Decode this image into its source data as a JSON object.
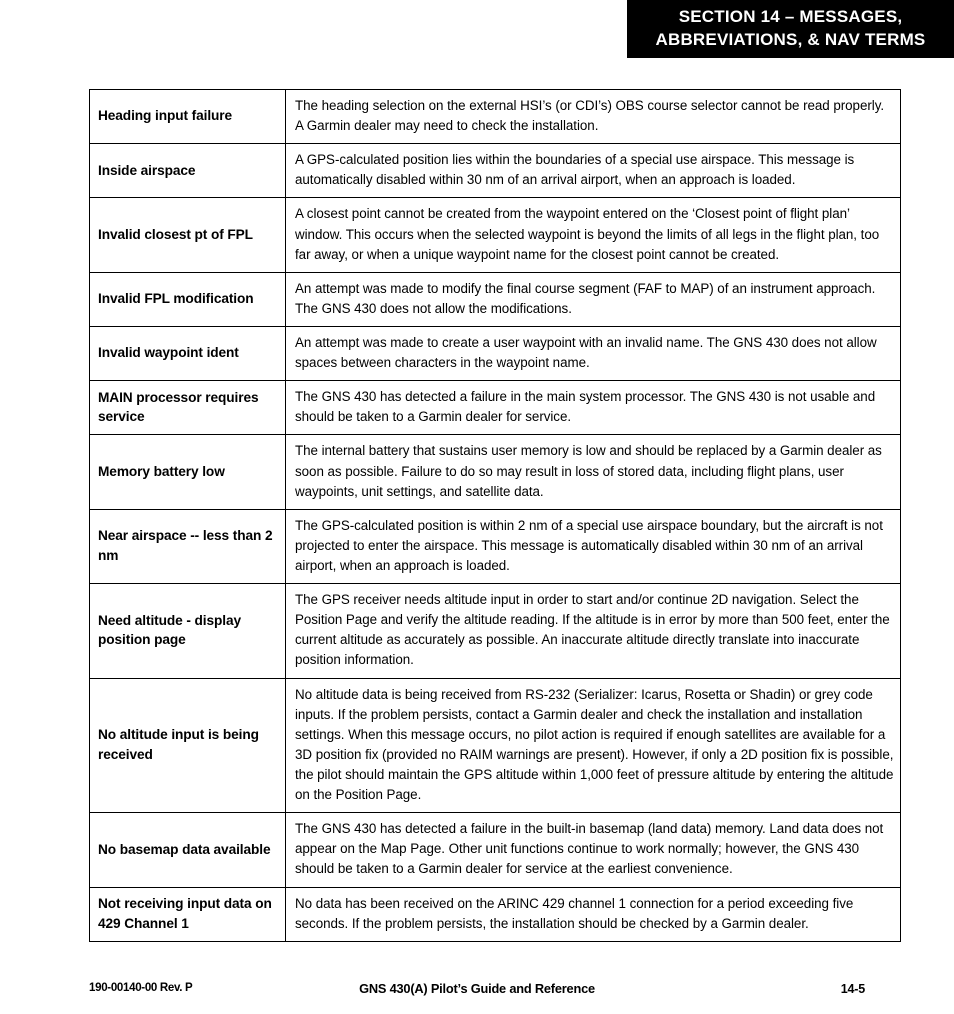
{
  "header": {
    "line1": "SECTION 14 – MESSAGES,",
    "line2": "ABBREVIATIONS, & NAV TERMS",
    "background_color": "#000000",
    "text_color": "#ffffff"
  },
  "table": {
    "rows": [
      {
        "message": "Heading input failure",
        "description": "The heading selection on the external HSI’s (or CDI’s) OBS course selector cannot be read properly.  A Garmin dealer may need to check the installation."
      },
      {
        "message": "Inside airspace",
        "description": "A GPS-calculated position lies within the boundaries of a special use airspace.  This message is automatically disabled within 30 nm of an arrival airport, when an approach is loaded."
      },
      {
        "message": "Invalid closest pt of FPL",
        "description": "A closest point cannot be created from the waypoint entered on the ‘Closest point of flight plan’ window.  This occurs when the selected waypoint is beyond the limits of all legs in the flight plan, too far away, or when a unique waypoint name for the closest point cannot be created."
      },
      {
        "message": "Invalid FPL modification",
        "description": "An attempt was made to modify the final course segment (FAF to MAP) of an instrument approach.  The GNS 430 does not allow the modifications."
      },
      {
        "message": "Invalid waypoint ident",
        "description": "An attempt was made to create a user waypoint with an invalid name.  The GNS 430 does not allow spaces between characters in the waypoint name."
      },
      {
        "message": "MAIN processor requires service",
        "description": "The GNS 430 has detected a failure in the main system processor.  The GNS 430 is not usable and should be taken to a Garmin dealer for service."
      },
      {
        "message": "Memory battery low",
        "description": "The internal battery that sustains user memory is low and should be replaced by a Garmin dealer as soon as possible.  Failure to do so may result in loss of stored data, including flight plans, user waypoints, unit settings, and satellite data."
      },
      {
        "message": "Near airspace -- less than 2 nm",
        "description": "The GPS-calculated position is within 2 nm of a special use airspace boundary, but the aircraft is  not projected to enter the airspace.  This message is automatically disabled within 30 nm of an arrival airport, when an approach is loaded."
      },
      {
        "message": "Need altitude - display position page",
        "description": "The GPS receiver needs altitude input in order to start and/or continue 2D navigation.  Select the Position Page and verify the altitude reading.  If the altitude is in error by more than 500 feet, enter the current altitude as accurately as possible.  An inaccurate altitude directly translate into inaccurate position information."
      },
      {
        "message": "No altitude input is being received",
        "description": "No altitude data is being received from RS-232 (Serializer: Icarus, Rosetta or Shadin) or grey code inputs.  If the problem persists, contact a Garmin dealer and check the installation and installation settings.  When this message occurs, no pilot action is required if enough satellites are available for a 3D position fix (provided no RAIM warnings are present).  However, if only a 2D position fix is possible, the pilot should maintain the GPS altitude within 1,000 feet of pressure altitude by entering the altitude on the Position Page."
      },
      {
        "message": "No basemap data available",
        "description": "The GNS 430 has detected a failure in the built-in basemap (land data) memory.  Land data does not appear on the Map Page.  Other unit functions continue to work normally; however, the GNS 430 should be taken to a Garmin dealer for service at the earliest convenience."
      },
      {
        "message": "Not receiving input data on 429 Channel 1",
        "description": "No data has been received on the ARINC 429 channel 1 connection for a period exceeding five seconds.  If the problem persists, the installation should be checked by a Garmin dealer."
      }
    ]
  },
  "footer": {
    "document_number": "190-00140-00  Rev. P",
    "title": "GNS 430(A) Pilot’s Guide and Reference",
    "page_number": "14-5"
  }
}
